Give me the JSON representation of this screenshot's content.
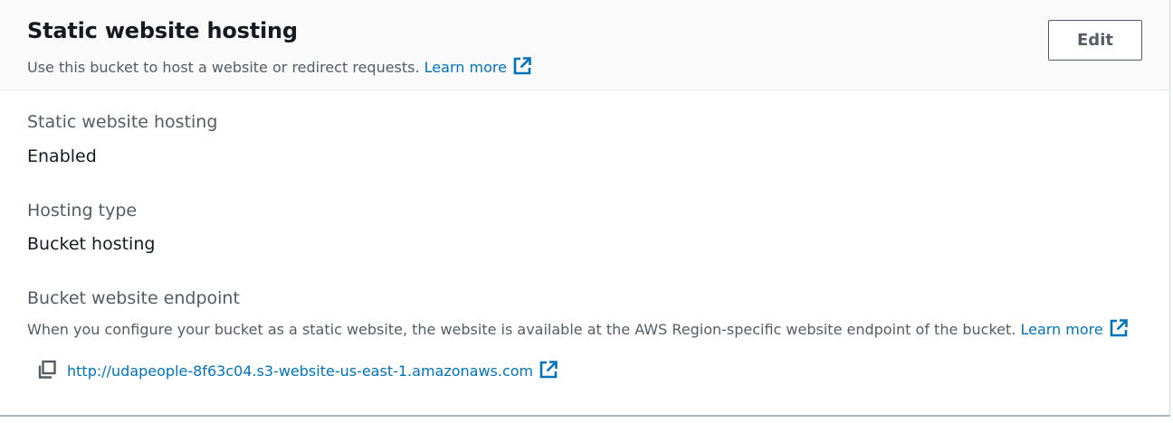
{
  "header": {
    "title": "Static website hosting",
    "description": "Use this bucket to host a website or redirect requests.",
    "learn_more": "Learn more",
    "edit_label": "Edit"
  },
  "fields": {
    "hosting": {
      "label": "Static website hosting",
      "value": "Enabled"
    },
    "hosting_type": {
      "label": "Hosting type",
      "value": "Bucket hosting"
    },
    "endpoint": {
      "label": "Bucket website endpoint",
      "description": "When you configure your bucket as a static website, the website is available at the AWS Region-specific website endpoint of the bucket.",
      "learn_more": "Learn more",
      "url": "http://udapeople-8f63c04.s3-website-us-east-1.amazonaws.com"
    }
  },
  "icons": {
    "external_link": "external-link-icon",
    "copy": "copy-icon"
  },
  "colors": {
    "link": "#0073bb",
    "text": "#16191f",
    "muted": "#545b64",
    "header_bg": "#fafafa"
  }
}
